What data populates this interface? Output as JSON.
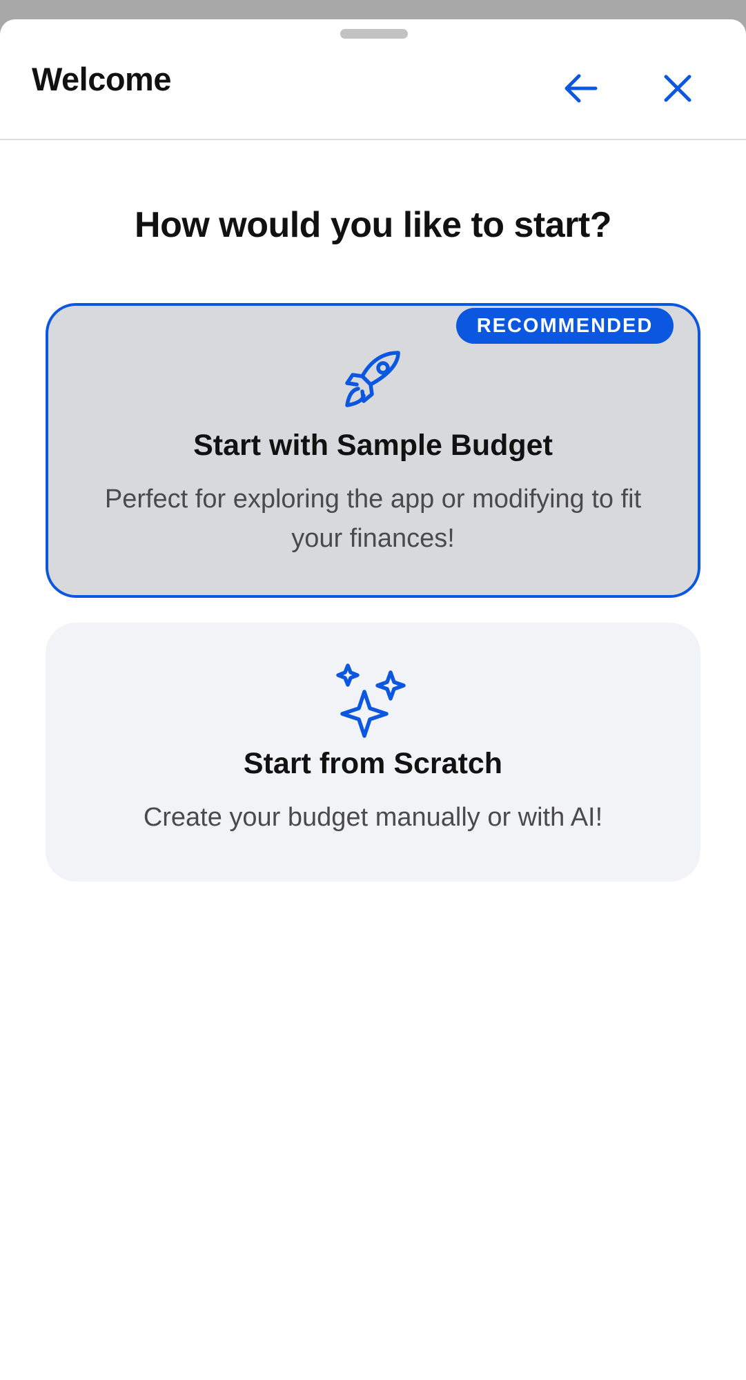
{
  "header": {
    "title": "Welcome",
    "back_icon": "arrow-left-icon",
    "close_icon": "close-icon"
  },
  "main": {
    "question": "How would you like to start?",
    "options": [
      {
        "badge": "RECOMMENDED",
        "icon": "rocket-icon",
        "title": "Start with Sample Budget",
        "description": "Perfect for exploring the app or modifying to fit your finances!",
        "selected": true
      },
      {
        "icon": "sparkles-icon",
        "title": "Start from Scratch",
        "description": "Create your budget manually or with AI!",
        "selected": false
      }
    ]
  },
  "colors": {
    "accent": "#0b57e0",
    "selected_card_bg": "#d8d9dc",
    "card_bg": "#f2f3f6",
    "text_primary": "#111111",
    "text_secondary": "#4a4a4e"
  }
}
